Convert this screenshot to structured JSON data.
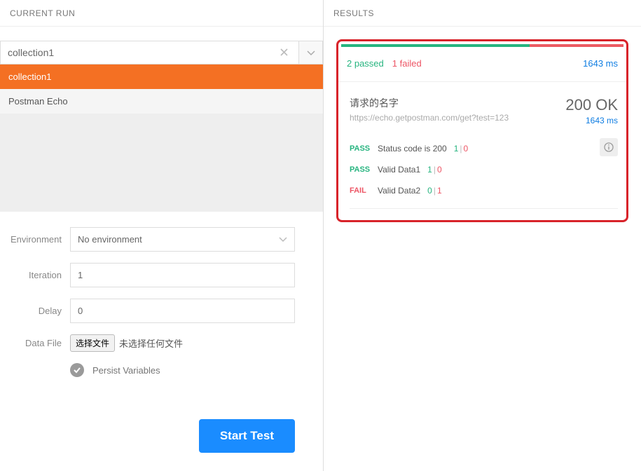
{
  "leftPanel": {
    "header": "CURRENT RUN",
    "collectionSelect": {
      "value": "collection1"
    },
    "collectionItems": [
      {
        "label": "collection1",
        "selected": true
      },
      {
        "label": "Postman Echo",
        "selected": false
      }
    ],
    "form": {
      "environment": {
        "label": "Environment",
        "value": "No environment"
      },
      "iteration": {
        "label": "Iteration",
        "value": "1"
      },
      "delay": {
        "label": "Delay",
        "value": "0"
      },
      "dataFile": {
        "label": "Data File",
        "buttonLabel": "选择文件",
        "statusText": "未选择任何文件"
      },
      "persistVariables": {
        "label": "Persist Variables",
        "checked": true
      }
    },
    "startButton": "Start Test"
  },
  "rightPanel": {
    "header": "RESULTS",
    "progress": {
      "passRatio": 2,
      "failRatio": 1
    },
    "summary": {
      "passedText": "2 passed",
      "failedText": "1 failed",
      "durationText": "1643 ms"
    },
    "request": {
      "name": "请求的名字",
      "url": "https://echo.getpostman.com/get?test=123",
      "statusCode": "200 OK",
      "statusTime": "1643 ms"
    },
    "tests": [
      {
        "result": "PASS",
        "name": "Status code is 200",
        "passCount": "1",
        "failCount": "0"
      },
      {
        "result": "PASS",
        "name": "Valid Data1",
        "passCount": "1",
        "failCount": "0"
      },
      {
        "result": "FAIL",
        "name": "Valid Data2",
        "passCount": "0",
        "failCount": "1"
      }
    ]
  }
}
